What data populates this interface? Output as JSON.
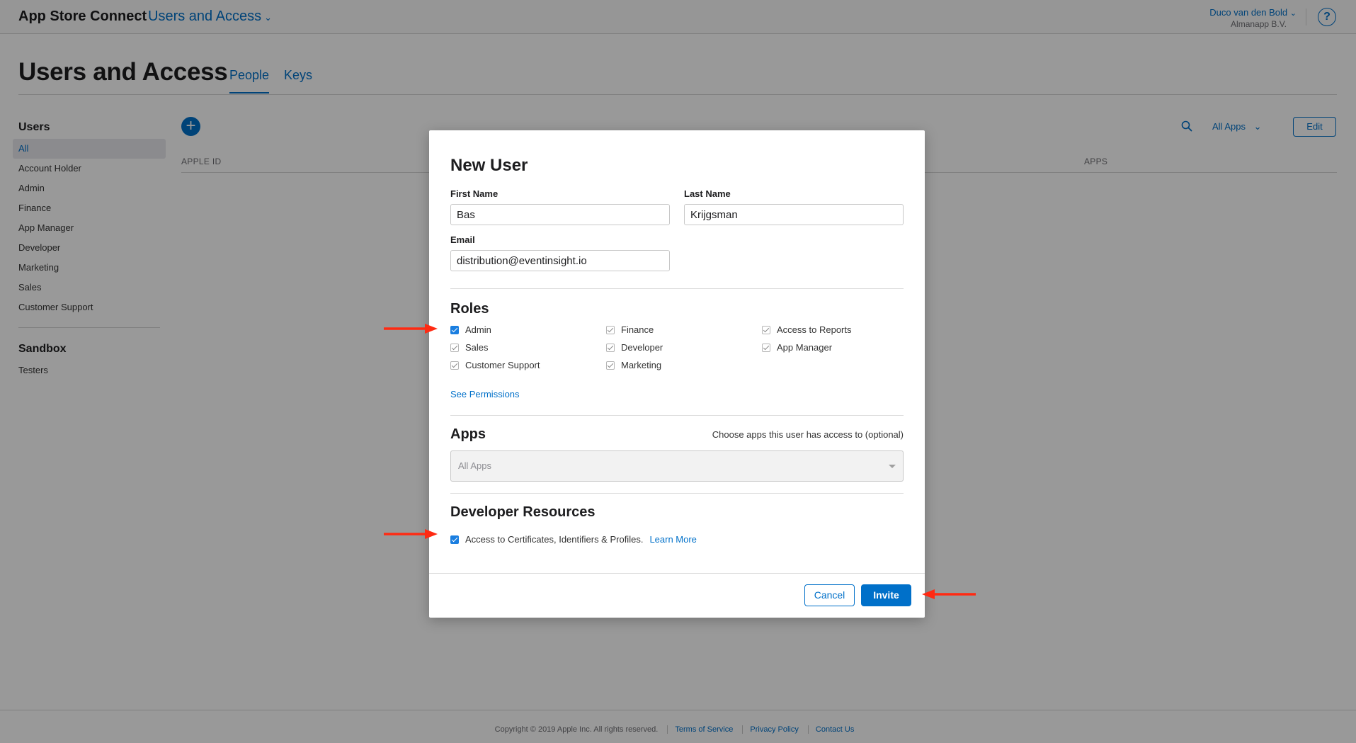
{
  "header": {
    "brand": "App Store Connect",
    "section": "Users and Access",
    "user_name": "Duco van den Bold",
    "user_org": "Almanapp B.V.",
    "help_label": "?"
  },
  "page": {
    "title": "Users and Access",
    "tabs": [
      {
        "label": "People",
        "active": true
      },
      {
        "label": "Keys",
        "active": false
      }
    ]
  },
  "sidebar": {
    "users_heading": "Users",
    "users_items": [
      {
        "label": "All",
        "active": true
      },
      {
        "label": "Account Holder"
      },
      {
        "label": "Admin"
      },
      {
        "label": "Finance"
      },
      {
        "label": "App Manager"
      },
      {
        "label": "Developer"
      },
      {
        "label": "Marketing"
      },
      {
        "label": "Sales"
      },
      {
        "label": "Customer Support"
      }
    ],
    "sandbox_heading": "Sandbox",
    "sandbox_items": [
      {
        "label": "Testers"
      }
    ]
  },
  "toolbar": {
    "add_label": "+",
    "filter_label": "All Apps",
    "edit_label": "Edit"
  },
  "table": {
    "columns": [
      "APPLE ID",
      "APPS"
    ]
  },
  "footer": {
    "copyright": "Copyright © 2019 Apple Inc. All rights reserved.",
    "links": [
      "Terms of Service",
      "Privacy Policy",
      "Contact Us"
    ]
  },
  "modal": {
    "title": "New User",
    "first_name_label": "First Name",
    "first_name_value": "Bas",
    "last_name_label": "Last Name",
    "last_name_value": "Krijgsman",
    "email_label": "Email",
    "email_value": "distribution@eventinsight.io",
    "roles_heading": "Roles",
    "roles": [
      {
        "label": "Admin",
        "checked": true,
        "highlight": true
      },
      {
        "label": "Finance",
        "checked": true
      },
      {
        "label": "Access to Reports",
        "checked": true
      },
      {
        "label": "Sales",
        "checked": true
      },
      {
        "label": "Developer",
        "checked": true
      },
      {
        "label": "App Manager",
        "checked": true
      },
      {
        "label": "Customer Support",
        "checked": true
      },
      {
        "label": "Marketing",
        "checked": true
      }
    ],
    "see_permissions": "See Permissions",
    "apps_heading": "Apps",
    "apps_hint": "Choose apps this user has access to (optional)",
    "apps_select_value": "All Apps",
    "dev_resources_heading": "Developer Resources",
    "dev_resources_checkbox": "Access to Certificates, Identifiers & Profiles.",
    "dev_resources_checked": true,
    "learn_more": "Learn More",
    "cancel_label": "Cancel",
    "invite_label": "Invite"
  },
  "colors": {
    "accent": "#0070c9",
    "annotation_arrow": "#ff2a12"
  }
}
